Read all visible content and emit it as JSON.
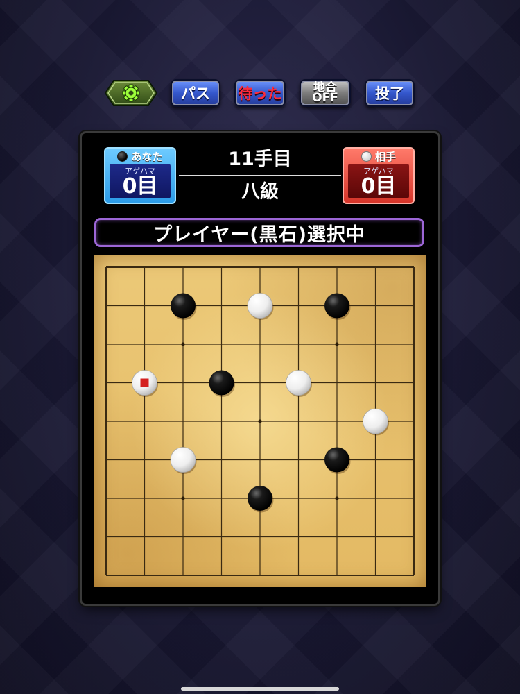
{
  "toolbar": {
    "settings_icon": "gear-icon",
    "pass_label": "パス",
    "undo_label": "待った",
    "territory_label_top": "地合",
    "territory_label_bottom": "OFF",
    "resign_label": "投了"
  },
  "players": {
    "you": {
      "name": "あなた",
      "stone": "black",
      "captures_label": "アゲハマ",
      "captures": "0目"
    },
    "opponent": {
      "name": "相手",
      "stone": "white",
      "captures_label": "アゲハマ",
      "captures": "0目"
    }
  },
  "game": {
    "move_count": "11手目",
    "rank": "八級",
    "status": "プレイヤー(黒石)選択中"
  },
  "board": {
    "size": 9,
    "stars": [
      [
        2,
        2
      ],
      [
        2,
        6
      ],
      [
        4,
        4
      ],
      [
        6,
        2
      ],
      [
        6,
        6
      ]
    ],
    "stones": [
      {
        "col": 2,
        "row": 1,
        "color": "black"
      },
      {
        "col": 4,
        "row": 1,
        "color": "white"
      },
      {
        "col": 6,
        "row": 1,
        "color": "black"
      },
      {
        "col": 1,
        "row": 3,
        "color": "white",
        "last_move": true
      },
      {
        "col": 3,
        "row": 3,
        "color": "black"
      },
      {
        "col": 5,
        "row": 3,
        "color": "white"
      },
      {
        "col": 7,
        "row": 4,
        "color": "white"
      },
      {
        "col": 2,
        "row": 5,
        "color": "white"
      },
      {
        "col": 6,
        "row": 5,
        "color": "black"
      },
      {
        "col": 4,
        "row": 6,
        "color": "black"
      }
    ],
    "last_move_marker_color": "#d42020"
  }
}
